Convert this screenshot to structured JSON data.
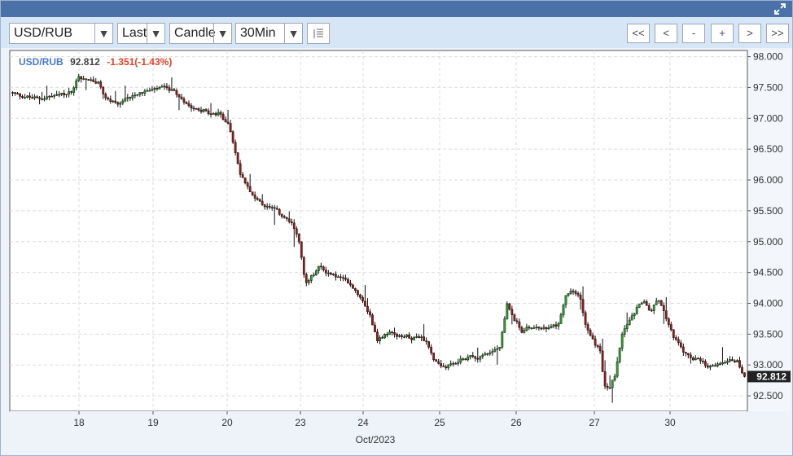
{
  "toolbar": {
    "symbol": "USD/RUB",
    "price_field": "Last",
    "chart_style": "Candle",
    "interval": "30Min",
    "nav_buttons": [
      "<<",
      "<",
      "-",
      "+",
      ">",
      ">>"
    ]
  },
  "header": {
    "symbol": "USD/RUB",
    "last": "92.812",
    "change": "-1.351(-1.43%)"
  },
  "colors": {
    "up": "#22aa22",
    "down": "#a01818",
    "wick": "#111111",
    "grid": "#dddddd",
    "price_tag": "#222222"
  },
  "chart_data": {
    "type": "candlestick",
    "title": "",
    "xlabel": "Oct/2023",
    "ylabel": "",
    "ylim": [
      92.25,
      98.1
    ],
    "y_ticks": [
      "98.000",
      "97.500",
      "97.000",
      "96.500",
      "96.000",
      "95.500",
      "95.000",
      "94.500",
      "94.000",
      "93.500",
      "93.000",
      "92.500"
    ],
    "x_ticks": [
      "18",
      "19",
      "20",
      "23",
      "24",
      "25",
      "26",
      "27",
      "30"
    ],
    "last_price": "92.812",
    "grid": true,
    "path": [
      [
        0,
        97.42
      ],
      [
        2,
        97.35
      ],
      [
        4,
        97.32
      ],
      [
        6,
        97.36
      ],
      [
        8,
        97.4
      ],
      [
        9,
        97.5
      ],
      [
        9.3,
        97.72
      ],
      [
        9.8,
        97.65
      ],
      [
        11,
        97.62
      ],
      [
        12.5,
        97.55
      ],
      [
        13,
        97.35
      ],
      [
        14,
        97.28
      ],
      [
        15,
        97.2
      ],
      [
        16,
        97.3
      ],
      [
        17,
        97.38
      ],
      [
        18,
        97.42
      ],
      [
        19,
        97.44
      ],
      [
        20,
        97.46
      ],
      [
        21,
        97.5
      ],
      [
        22,
        97.48
      ],
      [
        23,
        97.4
      ],
      [
        24,
        97.3
      ],
      [
        25,
        97.2
      ],
      [
        26,
        97.15
      ],
      [
        27,
        97.12
      ],
      [
        28,
        97.05
      ],
      [
        29,
        97.08
      ],
      [
        30,
        96.95
      ],
      [
        30.5,
        96.85
      ],
      [
        31,
        96.6
      ],
      [
        31.5,
        96.3
      ],
      [
        32,
        96.1
      ],
      [
        33,
        95.9
      ],
      [
        34,
        95.7
      ],
      [
        35,
        95.6
      ],
      [
        36,
        95.55
      ],
      [
        37,
        95.5
      ],
      [
        38,
        95.4
      ],
      [
        39,
        95.3
      ],
      [
        40,
        95.1
      ],
      [
        40.5,
        94.7
      ],
      [
        41,
        94.3
      ],
      [
        42,
        94.45
      ],
      [
        43,
        94.6
      ],
      [
        44,
        94.5
      ],
      [
        45,
        94.45
      ],
      [
        46,
        94.4
      ],
      [
        47,
        94.35
      ],
      [
        48,
        94.2
      ],
      [
        49,
        94.05
      ],
      [
        50,
        93.8
      ],
      [
        51,
        93.4
      ],
      [
        52,
        93.5
      ],
      [
        53,
        93.55
      ],
      [
        54,
        93.45
      ],
      [
        55,
        93.48
      ],
      [
        56,
        93.42
      ],
      [
        57,
        93.45
      ],
      [
        58,
        93.35
      ],
      [
        58.5,
        93.2
      ],
      [
        59,
        93.05
      ],
      [
        60,
        92.95
      ],
      [
        61,
        92.98
      ],
      [
        62,
        93.05
      ],
      [
        63,
        93.1
      ],
      [
        64,
        93.15
      ],
      [
        65,
        93.12
      ],
      [
        66,
        93.18
      ],
      [
        67,
        93.22
      ],
      [
        68,
        93.3
      ],
      [
        68.5,
        93.6
      ],
      [
        69,
        94.0
      ],
      [
        69.5,
        93.9
      ],
      [
        70,
        93.75
      ],
      [
        71,
        93.55
      ],
      [
        72,
        93.6
      ],
      [
        73,
        93.62
      ],
      [
        74,
        93.58
      ],
      [
        75,
        93.6
      ],
      [
        76,
        93.65
      ],
      [
        76.5,
        93.8
      ],
      [
        77,
        94.1
      ],
      [
        78,
        94.2
      ],
      [
        79,
        94.15
      ],
      [
        79.5,
        93.9
      ],
      [
        80,
        93.6
      ],
      [
        81,
        93.4
      ],
      [
        82,
        93.2
      ],
      [
        82.5,
        92.7
      ],
      [
        83,
        92.6
      ],
      [
        84,
        92.8
      ],
      [
        84.5,
        93.2
      ],
      [
        85,
        93.5
      ],
      [
        86,
        93.7
      ],
      [
        87,
        93.9
      ],
      [
        88,
        94.05
      ],
      [
        89,
        93.85
      ],
      [
        90,
        94.1
      ],
      [
        91,
        93.8
      ],
      [
        92,
        93.5
      ],
      [
        93,
        93.3
      ],
      [
        94,
        93.15
      ],
      [
        95,
        93.1
      ],
      [
        96,
        93.05
      ],
      [
        97,
        92.95
      ],
      [
        98,
        93.0
      ],
      [
        99,
        93.05
      ],
      [
        100,
        93.1
      ],
      [
        101,
        93.05
      ],
      [
        102,
        92.812
      ]
    ]
  }
}
